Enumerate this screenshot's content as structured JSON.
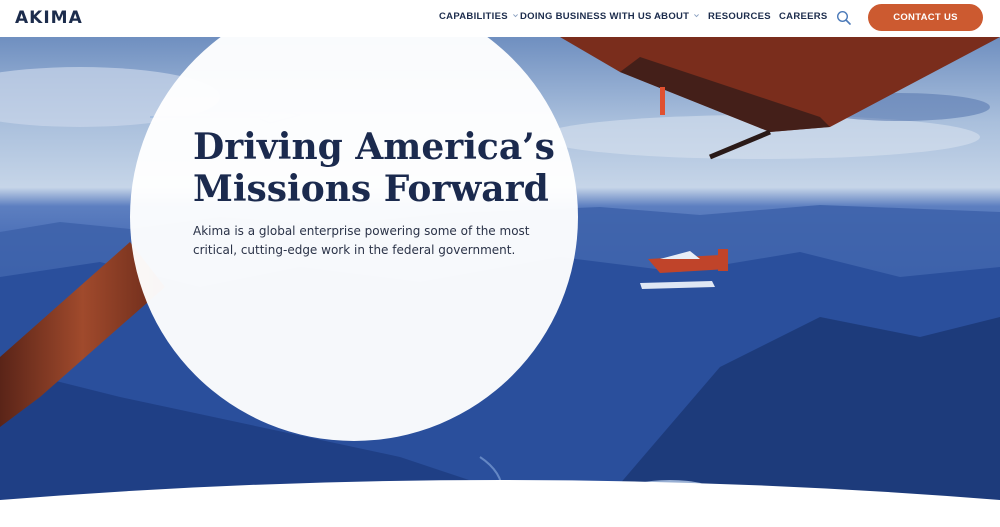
{
  "header": {
    "logo": "AKIMA",
    "nav": [
      {
        "label": "CAPABILITIES",
        "has_dropdown": true
      },
      {
        "label": "DOING BUSINESS WITH US",
        "has_dropdown": true
      },
      {
        "label": "ABOUT",
        "has_dropdown": true
      },
      {
        "label": "RESOURCES",
        "has_dropdown": false
      },
      {
        "label": "CAREERS",
        "has_dropdown": false
      }
    ],
    "search_icon": "search-icon",
    "contact_label": "CONTACT US"
  },
  "hero": {
    "title_line1": "Driving America’s",
    "title_line2": "Missions Forward",
    "subtitle": "Akima is a global enterprise powering some of the most critical, cutting-edge work in the federal government."
  },
  "colors": {
    "brand_navy": "#1b2a4e",
    "accent_orange": "#cc5a30"
  }
}
